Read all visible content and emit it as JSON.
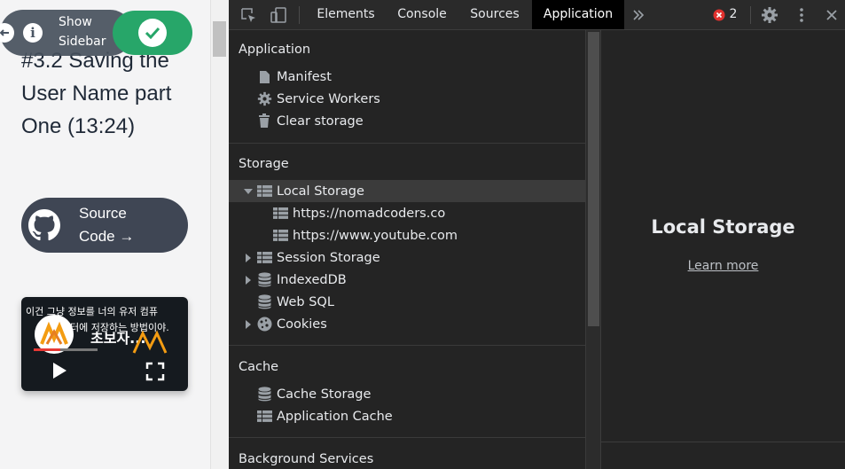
{
  "page": {
    "lesson_title": "#3.2 Saving the User Name part One (13:24)",
    "sidebar_toggle_label": "Show Sidebar",
    "source_code_label": "Source Code →",
    "video": {
      "caption": "이건 그냥 정보를 너의 유저 컴퓨",
      "caption_line2": "터에 저장하는 방법이야.",
      "title": "초보자..."
    }
  },
  "devtools": {
    "tabs": [
      "Elements",
      "Console",
      "Sources",
      "Application"
    ],
    "active_tab": "Application",
    "error_count": "2",
    "sections": [
      {
        "title": "Application",
        "items": [
          {
            "label": "Manifest",
            "icon": "file-icon"
          },
          {
            "label": "Service Workers",
            "icon": "gear-icon"
          },
          {
            "label": "Clear storage",
            "icon": "trash-icon"
          }
        ]
      },
      {
        "title": "Storage",
        "items": [
          {
            "label": "Local Storage",
            "icon": "table-icon",
            "expanded": true,
            "selected": true
          },
          {
            "label": "https://nomadcoders.co",
            "icon": "table-icon",
            "child": true
          },
          {
            "label": "https://www.youtube.com",
            "icon": "table-icon",
            "child": true
          },
          {
            "label": "Session Storage",
            "icon": "table-icon",
            "expandable": true
          },
          {
            "label": "IndexedDB",
            "icon": "database-icon",
            "expandable": true
          },
          {
            "label": "Web SQL",
            "icon": "database-icon"
          },
          {
            "label": "Cookies",
            "icon": "cookie-icon",
            "expandable": true
          }
        ]
      },
      {
        "title": "Cache",
        "items": [
          {
            "label": "Cache Storage",
            "icon": "database-icon"
          },
          {
            "label": "Application Cache",
            "icon": "table-icon"
          }
        ]
      },
      {
        "title": "Background Services",
        "items": []
      }
    ],
    "main": {
      "title": "Local Storage",
      "link": "Learn more"
    }
  },
  "colors": {
    "devtools_bg": "#242424",
    "selected_row": "#3b3b3b",
    "check_button": "#27a669",
    "error_badge": "#e0312e"
  }
}
